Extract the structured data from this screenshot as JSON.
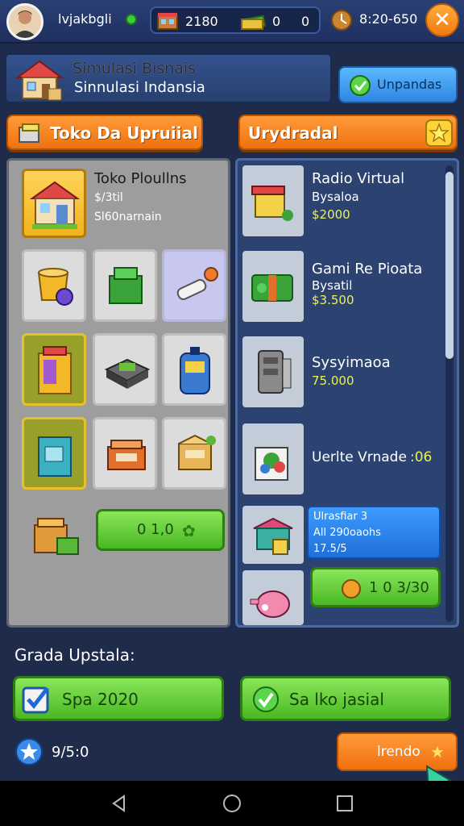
{
  "topbar": {
    "player_name": "lvjakbgli",
    "resource_1": "2180",
    "resource_2": "0",
    "resource_3": "0",
    "timer": "8:20-650"
  },
  "title_panel": {
    "title": "Simulasi Bisnais",
    "subtitle": "Sinnulasi Indansia",
    "updates_label": "Unpandas"
  },
  "left_header": "Toko Da Upruiial",
  "right_header": "Urydradal",
  "shop": {
    "featured_title": "Toko Ploullns",
    "featured_price": "$/3til",
    "featured_sub": "Sl60narnain",
    "buy_label": "0 1,0"
  },
  "upgrades": [
    {
      "name": "Radio Virtual",
      "sub": "Bysaloa",
      "price": "$2000"
    },
    {
      "name": "Gami Re Pioata",
      "sub": "Bysatil",
      "price": "$3.500"
    },
    {
      "name": "Sysyimaoa",
      "sub": "",
      "price": "75.000"
    },
    {
      "name": "Uerlte Vrnade",
      "sub": "",
      "price": ":06"
    }
  ],
  "info_box": {
    "line1": "Ulrasfiar 3",
    "line2": "All 290oaohs",
    "line3": "17.5/5"
  },
  "upgrade_buy_label": "1 0 3/30",
  "bottom": {
    "grade_label": "Grada Upstala:",
    "btn_left": "Spa 2020",
    "btn_right": "Sa lko jasial",
    "coin_value": "9/5:0",
    "next_label": "lrendo"
  },
  "colors": {
    "accent_orange": "#f0700f",
    "accent_green": "#49b822",
    "panel_blue": "#2c4270",
    "panel_grey": "#9d9d9d"
  }
}
